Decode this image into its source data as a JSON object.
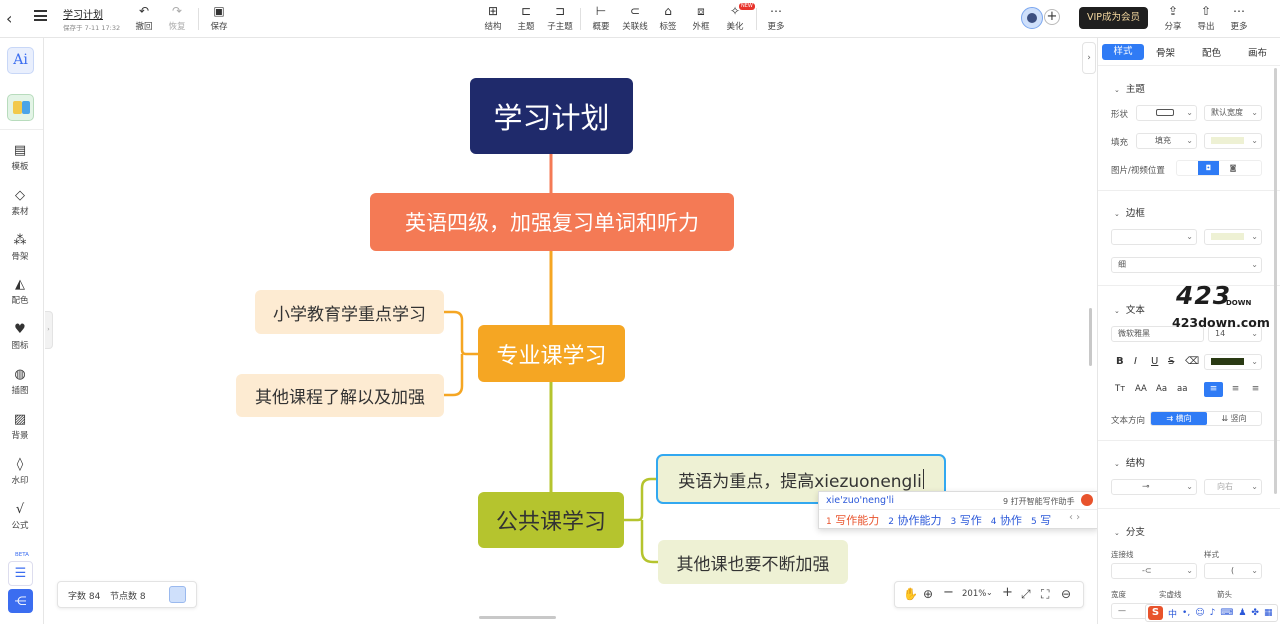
{
  "topbar": {
    "doc_title": "学习计划",
    "save_status": "保存于 7-11 17:32",
    "undo": "撤回",
    "redo": "恢复",
    "save": "保存",
    "tools": [
      "结构",
      "主题",
      "子主题",
      "概要",
      "关联线",
      "标签",
      "外框",
      "美化",
      "更多"
    ],
    "new_badge": "NEW",
    "vip_label": "VIP成为会员",
    "share": "分享",
    "export": "导出",
    "more": "更多"
  },
  "sidebar": {
    "ai_label": "Ai",
    "items": [
      "模板",
      "素材",
      "骨架",
      "配色",
      "图标",
      "插图",
      "背景",
      "水印",
      "公式"
    ],
    "beta_badge": "BETA"
  },
  "mindmap": {
    "root": "学习计划",
    "branch1": "英语四级，加强复习单词和听力",
    "branch2": "专业课学习",
    "branch2_children": [
      "小学教育学重点学习",
      "其他课程了解以及加强"
    ],
    "branch3": "公共课学习",
    "branch3_children": [
      "英语为重点，提高xiezuonengli",
      "其他课也要不断加强"
    ]
  },
  "ime": {
    "pinyin": "xie'zuo'neng'li",
    "assistant": "9 打开智能写作助手",
    "candidates": [
      {
        "num": "1",
        "text": "写作能力"
      },
      {
        "num": "2",
        "text": "协作能力"
      },
      {
        "num": "3",
        "text": "写作"
      },
      {
        "num": "4",
        "text": "协作"
      },
      {
        "num": "5",
        "text": "写"
      }
    ]
  },
  "stats": {
    "word_count": "字数 84",
    "node_count": "节点数 8"
  },
  "zoom": {
    "level": "201%"
  },
  "right_panel": {
    "tabs": [
      "样式",
      "骨架",
      "配色",
      "画布"
    ],
    "active_tab": "样式",
    "theme_section": "主题",
    "shape_label": "形状",
    "width_value": "默认宽度",
    "fill_label": "填充",
    "fill_value": "填充",
    "image_pos_label": "图片/视频位置",
    "border_section": "边框",
    "border_thickness": "细",
    "text_section": "文本",
    "font_value": "微软雅黑",
    "font_size": "14",
    "text_dir_label": "文本方向",
    "text_dir_h": "横向",
    "text_dir_v": "竖向",
    "structure_section": "结构",
    "structure_dir": "向右",
    "branch_section": "分支",
    "connector_label": "连接线",
    "style_label": "样式",
    "width_label": "宽度",
    "solid_label": "实虚线",
    "arrow_label": "箭头"
  },
  "watermark": {
    "top": "423",
    "mid": "DOWN",
    "bottom": "423down.com"
  },
  "colors": {
    "root": "#1f2a6b",
    "branch1": "#f47a55",
    "branch2": "#f5a623",
    "branch3": "#b5c42e",
    "child2": "#fdebd2",
    "child3": "#eef1d4",
    "accent": "#2f7bf5",
    "ime_highlight": "#e8532c"
  }
}
